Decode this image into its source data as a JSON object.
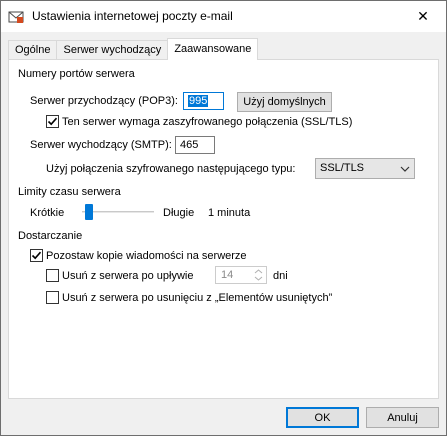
{
  "window": {
    "title": "Ustawienia internetowej poczty e-mail",
    "close_glyph": "✕"
  },
  "tabs": [
    {
      "label": "Ogólne",
      "active": false
    },
    {
      "label": "Serwer wychodzący",
      "active": false
    },
    {
      "label": "Zaawansowane",
      "active": true
    }
  ],
  "ports": {
    "group_label": "Numery portów serwera",
    "incoming_label": "Serwer przychodzący (POP3):",
    "incoming_value": "995",
    "use_defaults_label": "Użyj domyślnych",
    "encrypted_checkbox_label": "Ten serwer wymaga zaszyfrowanego połączenia (SSL/TLS)",
    "encrypted_checked": true,
    "outgoing_label": "Serwer wychodzący (SMTP):",
    "outgoing_value": "465",
    "encryption_type_label": "Użyj połączenia szyfrowanego następującego typu:",
    "encryption_type_value": "SSL/TLS"
  },
  "timeouts": {
    "group_label": "Limity czasu serwera",
    "short_label": "Krótkie",
    "long_label": "Długie",
    "value_text": "1 minuta",
    "slider_level": 0.05
  },
  "delivery": {
    "group_label": "Dostarczanie",
    "leave_copy_label": "Pozostaw kopie wiadomości na serwerze",
    "leave_copy_checked": true,
    "remove_after_label": "Usuń z serwera po upływie",
    "remove_after_checked": false,
    "remove_after_days": "14",
    "days_label": "dni",
    "remove_deleted_label": "Usuń z serwera po usunięciu z „Elementów usuniętych”",
    "remove_deleted_checked": false
  },
  "footer": {
    "ok_label": "OK",
    "cancel_label": "Anuluj"
  },
  "colors": {
    "accent": "#0078d7",
    "dialog_bg": "#f0f0f0",
    "panel_bg": "#ffffff"
  }
}
